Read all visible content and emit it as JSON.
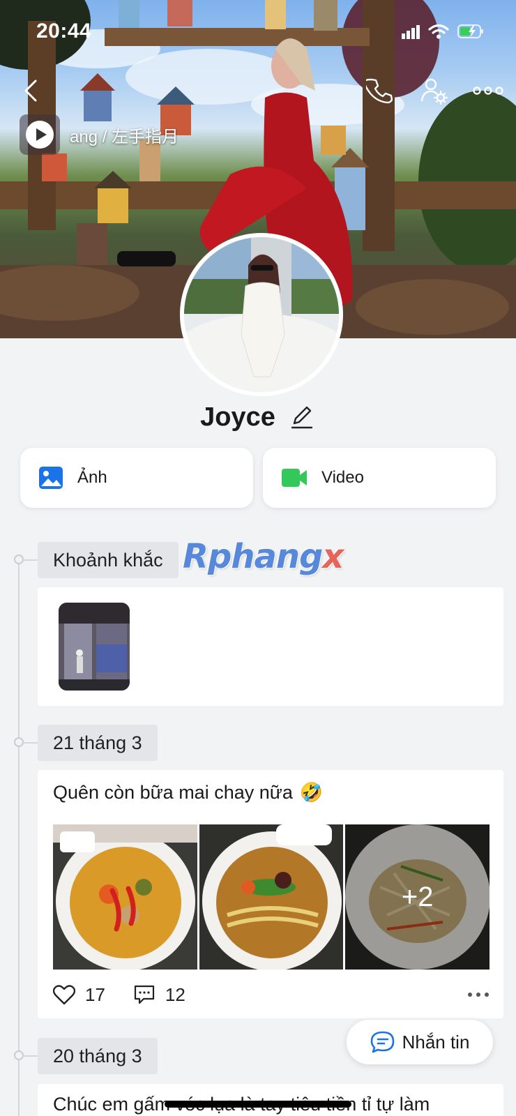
{
  "status_bar": {
    "time": "20:44"
  },
  "cover": {
    "music": {
      "title": "ang / 左手指月"
    }
  },
  "profile": {
    "name": "Joyce"
  },
  "media_buttons": {
    "photos": "Ảnh",
    "video": "Video"
  },
  "timeline": {
    "moments": {
      "label": "Khoảnh khắc"
    },
    "posts": [
      {
        "date": "21 tháng 3",
        "text": "Quên còn bữa mai chay nữa",
        "emoji": "🤣",
        "extra_photos": "+2",
        "likes": "17",
        "comments": "12"
      },
      {
        "date": "20 tháng 3",
        "text": "Chúc em gấm vóc lụa là tay tiêu tiền tỉ tự làm"
      }
    ]
  },
  "watermark": {
    "main": "Rphang",
    "accent": "x"
  },
  "message_button": {
    "label": "Nhắn tin"
  },
  "colors": {
    "accent_blue": "#1a73e8",
    "video_green": "#34c759",
    "background": "#f2f3f5"
  },
  "icons": [
    "back-icon",
    "phone-icon",
    "user-settings-icon",
    "more-icon",
    "play-icon",
    "edit-icon",
    "image-icon",
    "video-camera-icon",
    "heart-icon",
    "comment-icon",
    "chat-icon"
  ]
}
